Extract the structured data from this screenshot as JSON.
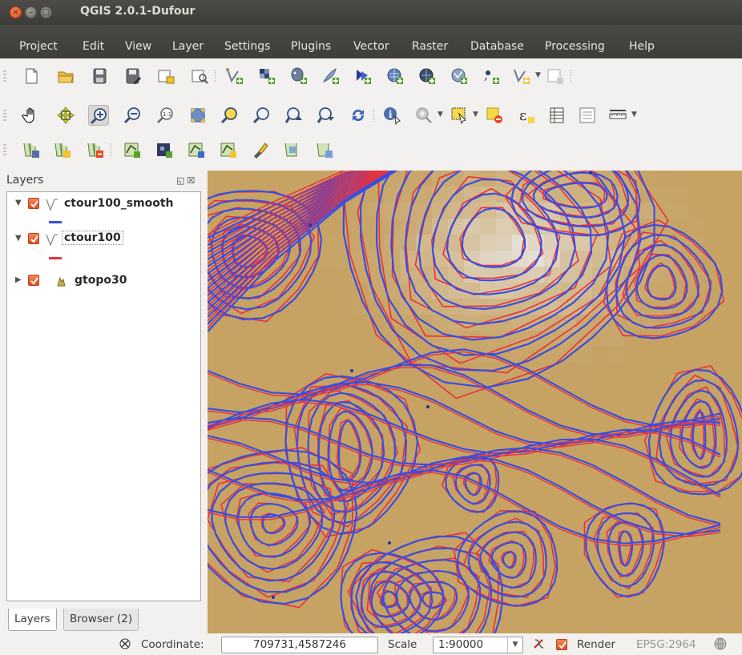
{
  "window": {
    "title": "QGIS 2.0.1-Dufour",
    "close_glyph": "×",
    "min_glyph": "–",
    "max_glyph": "□"
  },
  "menu": [
    {
      "label": "Project",
      "id": "project"
    },
    {
      "label": "Edit",
      "id": "edit"
    },
    {
      "label": "View",
      "id": "view"
    },
    {
      "label": "Layer",
      "id": "layer"
    },
    {
      "label": "Settings",
      "id": "settings"
    },
    {
      "label": "Plugins",
      "id": "plugins"
    },
    {
      "label": "Vector",
      "id": "vector"
    },
    {
      "label": "Raster",
      "id": "raster"
    },
    {
      "label": "Database",
      "id": "database"
    },
    {
      "label": "Processing",
      "id": "processing"
    },
    {
      "label": "Help",
      "id": "help"
    }
  ],
  "toolbars": {
    "file": [
      "new-project-icon",
      "open-project-icon",
      "save-project-icon",
      "save-as-icon",
      "new-print-composer-icon",
      "composer-manager-icon"
    ],
    "layers": [
      "add-vector-layer-icon",
      "add-raster-layer-icon",
      "add-postgis-layer-icon",
      "add-spatialite-layer-icon",
      "add-mssql-layer-icon",
      "add-wms-layer-icon",
      "add-wcs-layer-icon",
      "add-wfs-layer-icon",
      "add-delimited-text-icon",
      "new-shapefile-icon",
      "new-temporary-layer-icon"
    ],
    "navigation": [
      "pan-icon",
      "pan-to-selection-icon",
      "zoom-in-icon",
      "zoom-out-icon",
      "zoom-actual-size-icon",
      "zoom-full-icon",
      "zoom-to-selection-icon",
      "zoom-to-layer-icon",
      "zoom-last-icon",
      "zoom-next-icon",
      "refresh-icon"
    ],
    "attributes": [
      "identify-icon",
      "run-action-icon",
      "select-features-icon",
      "deselect-icon",
      "field-calculator-icon",
      "attribute-table-icon",
      "statistical-summary-icon",
      "measure-line-icon"
    ],
    "manage": [
      "add-layer-group-icon",
      "add-layer-icon",
      "remove-layer-icon",
      "new-vector-layer-icon",
      "edit-layer-icon",
      "toggle-editing-icon",
      "save-edits-icon",
      "digitize-icon",
      "raster-calculator-icon",
      "georeferencer-icon"
    ]
  },
  "layers_panel": {
    "title": "Layers",
    "float_glyph": "◱",
    "close_glyph": "☒",
    "items": [
      {
        "name": "ctour100_smooth",
        "checked": true,
        "expanded": true,
        "type": "vector-line",
        "legend_color": "#3a4de0"
      },
      {
        "name": "ctour100",
        "checked": true,
        "expanded": true,
        "type": "vector-line",
        "legend_color": "#e8323c"
      },
      {
        "name": "gtopo30",
        "checked": true,
        "expanded": false,
        "type": "raster"
      }
    ],
    "tabs": [
      {
        "label": "Layers",
        "active": true
      },
      {
        "label": "Browser (2)",
        "active": false
      }
    ]
  },
  "map": {
    "raster_color": "#c6a263",
    "contour_raw_color": "#e8323c",
    "contour_smooth_color": "#3a4de0"
  },
  "statusbar": {
    "coordinate_label": "Coordinate:",
    "coordinate_value": "709731,4587246",
    "scale_label": "Scale",
    "scale_value": "1:90000",
    "render_label": "Render",
    "render_checked": true,
    "crs_label": "EPSG:2964"
  }
}
